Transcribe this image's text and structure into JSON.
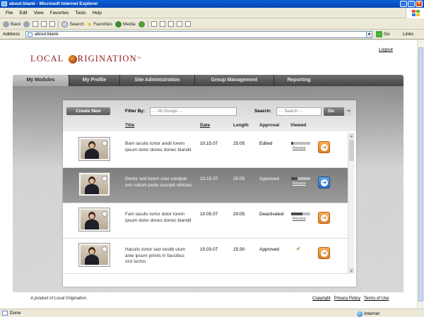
{
  "window": {
    "title": "about:blank - Microsoft Internet Explorer"
  },
  "menu": [
    "File",
    "Edit",
    "View",
    "Favorites",
    "Tools",
    "Help"
  ],
  "toolbar": {
    "back": "Back",
    "search": "Search",
    "favorites": "Favorites",
    "media": "Media"
  },
  "address": {
    "label": "Address",
    "value": "about:blank",
    "go": "Go",
    "links": "Links"
  },
  "status": {
    "left": "Done",
    "zone": "Internet"
  },
  "app": {
    "logo_left": "LOCAL",
    "logo_right": "RIGINATION",
    "logo_tm": "™",
    "logout": "Logout",
    "tabs": [
      {
        "label": "My Modules",
        "active": true
      },
      {
        "label": "My Profile",
        "active": false
      },
      {
        "label": "Site Administration",
        "active": false
      },
      {
        "label": "Group Management",
        "active": false
      },
      {
        "label": "Reporting",
        "active": false
      }
    ],
    "create_new": "Create New",
    "filter_label": "Filter By:",
    "filter_value": "- - All Groups - -",
    "search_label": "Search:",
    "search_placeholder": "- - Search - -",
    "search_go": "Go",
    "columns": {
      "title": "Title",
      "date": "Date",
      "length": "Length",
      "approval": "Approval",
      "viewed": "Viewed"
    },
    "rows": [
      {
        "title": "Bam iaculis tortor andit lorem ipsum dolor donec donec blandit",
        "date": "10.15.07",
        "length": "25:05",
        "approval": "Edited",
        "viewed": "resume",
        "progress": 0.1,
        "resume": "Resume",
        "selected": false
      },
      {
        "title": "Dortor sed lorem cras volutpat orci rutrum pede suscipit ultricies",
        "date": "10.15.07",
        "length": "25:05",
        "approval": "Approved",
        "viewed": "resume",
        "progress": 0.35,
        "resume": "Resume",
        "selected": true
      },
      {
        "title": "Fam iaculis tortor dolor lorem ipsum dolor donec donec blandit",
        "date": "10.05.07",
        "length": "20:05",
        "approval": "Deactivated",
        "viewed": "resume",
        "progress": 0.6,
        "resume": "Resume",
        "selected": false
      },
      {
        "title": "Haculis tortor sed vestib ulum ante ipsum primis in faucibus orci luctus",
        "date": "10.03.07",
        "length": "15:30",
        "approval": "Approved",
        "viewed": "check",
        "progress": 1,
        "resume": "",
        "selected": false
      }
    ],
    "footer_left": "A product of Local Origination.",
    "footer_links": [
      "Copyright",
      "Privacy Policy",
      "Terms of Use"
    ]
  },
  "colors": {
    "accent_orange": "#e0812a",
    "accent_blue": "#2a6fc4",
    "logo_red": "#8b1a1a"
  }
}
